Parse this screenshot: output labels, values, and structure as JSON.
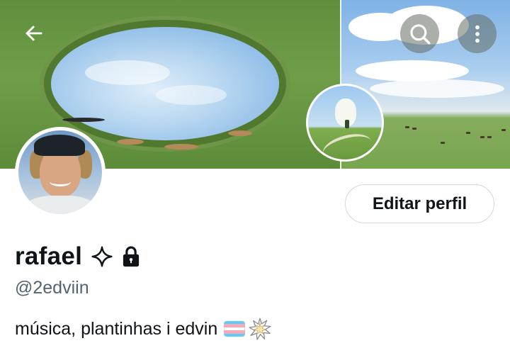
{
  "header": {
    "back_icon": "arrow-left-icon",
    "search_icon": "search-icon",
    "more_icon": "more-vertical-icon"
  },
  "profile": {
    "display_name": "rafael",
    "name_icons": [
      "sparkle-icon",
      "lock-icon"
    ],
    "handle": "@2edviin",
    "bio": "música, plantinhas i edvin",
    "bio_emojis": [
      "transgender-flag-icon",
      "anger-symbol-icon"
    ],
    "edit_button_label": "Editar perfil"
  },
  "colors": {
    "text_primary": "#0f1419",
    "text_secondary": "#536471",
    "button_border": "#cfd9de",
    "trans_flag": [
      "#5bcefa",
      "#f5a9b8",
      "#ffffff",
      "#f5a9b8",
      "#5bcefa"
    ]
  }
}
